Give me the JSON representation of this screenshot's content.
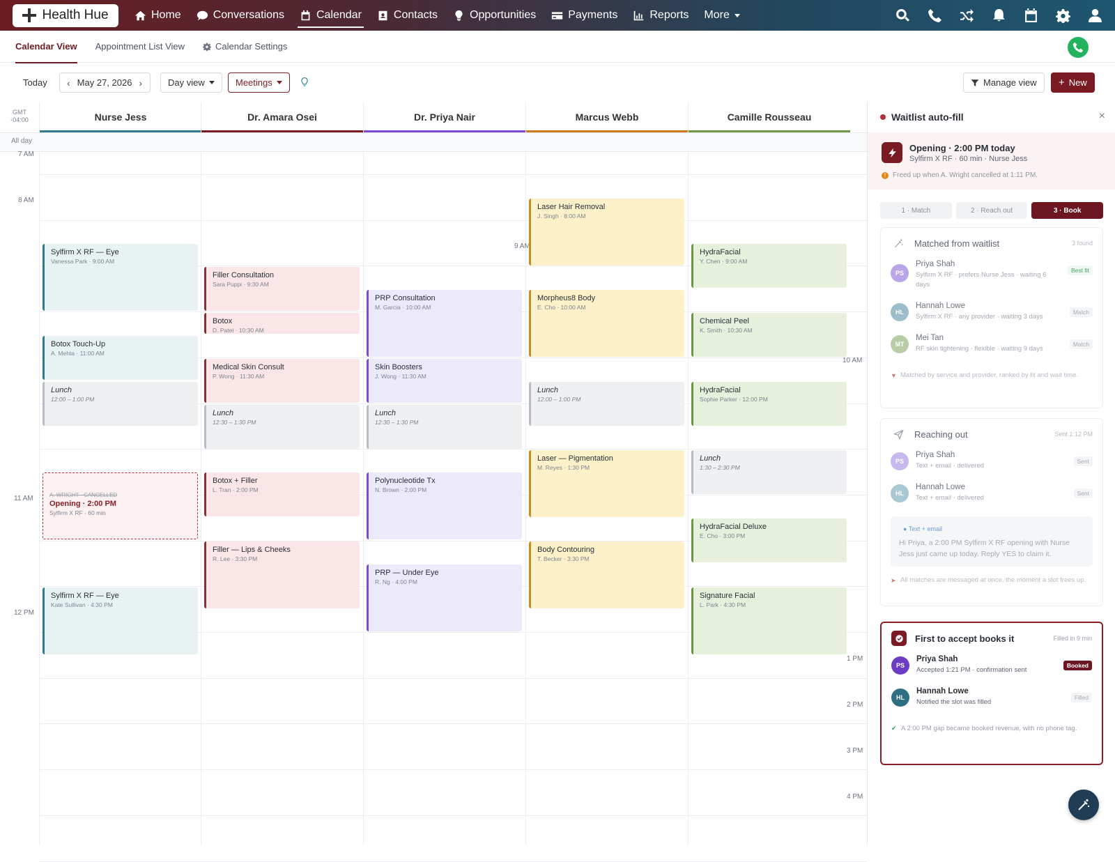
{
  "app": {
    "logo_text": "Health Hue"
  },
  "nav": {
    "items": [
      {
        "label": "Home",
        "icon": "home-icon"
      },
      {
        "label": "Conversations",
        "icon": "chat-icon"
      },
      {
        "label": "Calendar",
        "icon": "calendar-icon"
      },
      {
        "label": "Contacts",
        "icon": "contacts-icon"
      },
      {
        "label": "Opportunities",
        "icon": "lightbulb-icon"
      },
      {
        "label": "Payments",
        "icon": "card-icon"
      },
      {
        "label": "Reports",
        "icon": "chart-icon"
      },
      {
        "label": "More",
        "icon": "chevron-down-icon"
      }
    ],
    "active": "Calendar",
    "right_icons": [
      "search-icon",
      "phone-icon",
      "shuffle-icon",
      "bell-icon",
      "calendar-icon",
      "gear-icon",
      "user-icon"
    ]
  },
  "subnav": {
    "tabs": [
      "Calendar View",
      "Appointment List View",
      "Calendar Settings"
    ],
    "active": "Calendar View"
  },
  "toolbar": {
    "today": "Today",
    "date": "May 27, 2026",
    "view": "Day view",
    "filter": "Meetings",
    "manage_view": "Manage view",
    "new": "New"
  },
  "calendar": {
    "timezone": "GMT",
    "offset": "-04:00",
    "all_day": "All day",
    "providers": [
      {
        "name": "Nurse Jess",
        "color": "#2d7c8c"
      },
      {
        "name": "Dr. Amara Osei",
        "color": "#7a1a22"
      },
      {
        "name": "Dr. Priya Nair",
        "color": "#7c4bd0"
      },
      {
        "name": "Marcus Webb",
        "color": "#d0781d"
      },
      {
        "name": "Camille Rousseau",
        "color": "#6c9845"
      }
    ],
    "time_labels": [
      {
        "label": "7 AM",
        "col": 0
      },
      {
        "label": "8 AM",
        "col": 0
      },
      {
        "label": "9 AM",
        "col": 2
      },
      {
        "label": "10 AM",
        "col": 4
      },
      {
        "label": "11 AM",
        "col": 0
      },
      {
        "label": "12 PM",
        "col": 0
      },
      {
        "label": "1 PM",
        "col": 4
      },
      {
        "label": "2 PM",
        "col": 4
      },
      {
        "label": "3 PM",
        "col": 4
      },
      {
        "label": "4 PM",
        "col": 4
      }
    ],
    "events": [
      {
        "col": 0,
        "title": "Sylfirm X RF — Eye",
        "sub": "Vanessa Park · 9:00 AM",
        "style": "teal"
      },
      {
        "col": 0,
        "title": "Botox Touch-Up",
        "sub": "A. Mehta · 11:00 AM",
        "style": "teal"
      },
      {
        "col": 0,
        "title": "Lunch",
        "sub": "12:00 – 1:00 PM",
        "style": "grey"
      },
      {
        "col": 0,
        "title": "Opening · 2:00 PM",
        "sub": "Sylfirm X RF · 60 min",
        "struck": "A. WRIGHT · CANCELLED",
        "style": "opening"
      },
      {
        "col": 0,
        "title": "Sylfirm X RF — Eye",
        "sub": "Kate Sullivan · 4:30 PM",
        "style": "teal"
      },
      {
        "col": 1,
        "title": "Filler Consultation",
        "sub": "Sara Puppi · 9:30 AM",
        "style": "red"
      },
      {
        "col": 1,
        "title": "Botox",
        "sub": "D. Patel · 10:30 AM",
        "style": "red"
      },
      {
        "col": 1,
        "title": "Medical Skin Consult",
        "sub": "P. Wong · 11:30 AM",
        "style": "red"
      },
      {
        "col": 1,
        "title": "Lunch",
        "sub": "12:30 – 1:30 PM",
        "style": "grey"
      },
      {
        "col": 1,
        "title": "Botox + Filler",
        "sub": "L. Tran · 2:00 PM",
        "style": "red"
      },
      {
        "col": 1,
        "title": "Filler — Lips & Cheeks",
        "sub": "R. Lee · 3:30 PM",
        "style": "red"
      },
      {
        "col": 2,
        "title": "PRP Consultation",
        "sub": "M. Garcia · 10:00 AM",
        "style": "purple"
      },
      {
        "col": 2,
        "title": "Skin Boosters",
        "sub": "J. Wong · 11:30 AM",
        "style": "purple"
      },
      {
        "col": 2,
        "title": "Lunch",
        "sub": "12:30 – 1:30 PM",
        "style": "grey"
      },
      {
        "col": 2,
        "title": "Polynucleotide Tx",
        "sub": "N. Brown · 2:00 PM",
        "style": "purple"
      },
      {
        "col": 2,
        "title": "PRP — Under Eye",
        "sub": "R. Ng · 4:00 PM",
        "style": "purple"
      },
      {
        "col": 3,
        "title": "Laser Hair Removal",
        "sub": "J. Singh · 8:00 AM",
        "style": "yellow"
      },
      {
        "col": 3,
        "title": "Morpheus8 Body",
        "sub": "E. Cho · 10:00 AM",
        "style": "yellow"
      },
      {
        "col": 3,
        "title": "Lunch",
        "sub": "12:00 – 1:00 PM",
        "style": "grey"
      },
      {
        "col": 3,
        "title": "Laser — Pigmentation",
        "sub": "M. Reyes · 1:30 PM",
        "style": "yellow"
      },
      {
        "col": 3,
        "title": "Body Contouring",
        "sub": "T. Becker · 3:30 PM",
        "style": "yellow"
      },
      {
        "col": 4,
        "title": "HydraFacial",
        "sub": "Y. Chen · 9:00 AM",
        "style": "green"
      },
      {
        "col": 4,
        "title": "Chemical Peel",
        "sub": "K. Smith · 10:30 AM",
        "style": "green"
      },
      {
        "col": 4,
        "title": "HydraFacial",
        "sub": "Sophie Parker · 12:00 PM",
        "style": "green"
      },
      {
        "col": 4,
        "title": "Lunch",
        "sub": "1:30 – 2:30 PM",
        "style": "grey"
      },
      {
        "col": 4,
        "title": "HydraFacial Deluxe",
        "sub": "E. Cho · 3:00 PM",
        "style": "green"
      },
      {
        "col": 4,
        "title": "Signature Facial",
        "sub": "L. Park · 4:30 PM",
        "style": "green"
      }
    ]
  },
  "panel": {
    "title": "Waitlist auto-fill",
    "opening_title": "Opening · 2:00 PM today",
    "opening_sub": "Sylfirm X RF · 60 min · Nurse Jess",
    "opening_note": "Freed up when A. Wright cancelled at 1:11 PM.",
    "steps": [
      "1 · Match",
      "2 · Reach out",
      "3 · Book"
    ],
    "active_step": 2,
    "match": {
      "title": "Matched from waitlist",
      "meta": "3 found",
      "rows": [
        {
          "initials": "PS",
          "color": "#9b7fe0",
          "name": "Priya Shah",
          "desc": "Sylfirm X RF · prefers Nurse Jess · waiting 6 days",
          "tag": "Best fit"
        },
        {
          "initials": "HL",
          "color": "#7aa5b5",
          "name": "Hannah Lowe",
          "desc": "Sylfirm X RF · any provider · waiting 3 days",
          "tag": "Match"
        },
        {
          "initials": "MT",
          "color": "#a6c08e",
          "name": "Mei Tan",
          "desc": "RF skin tightening · flexible · waiting 9 days",
          "tag": "Match"
        }
      ],
      "foot": "Matched by service and provider, ranked by fit and wait time."
    },
    "reach": {
      "title": "Reaching out",
      "meta": "Sent 1:12 PM",
      "rows": [
        {
          "initials": "PS",
          "color": "#b9a6ea",
          "name": "Priya Shah",
          "desc": "Text + email · delivered",
          "tag": "Sent"
        },
        {
          "initials": "HL",
          "color": "#9cbdc9",
          "name": "Hannah Lowe",
          "desc": "Text + email · delivered",
          "tag": "Sent"
        }
      ],
      "msg_label": "Text + email",
      "msg": "Hi Priya, a 2:00 PM Sylfirm X RF opening with Nurse Jess just came up today. Reply YES to claim it.",
      "foot": "All matches are messaged at once, the moment a slot frees up."
    },
    "book": {
      "title": "First to accept books it",
      "meta": "Filled in 9 min",
      "rows": [
        {
          "initials": "PS",
          "color": "#6d3cc4",
          "name": "Priya Shah",
          "desc": "Accepted 1:21 PM · confirmation sent",
          "tag": "Booked"
        },
        {
          "initials": "HL",
          "color": "#2f6f84",
          "name": "Hannah Lowe",
          "desc": "Notified the slot was filled",
          "tag": "Filled"
        }
      ],
      "foot": "A 2:00 PM gap became booked revenue, with no phone tag."
    }
  }
}
